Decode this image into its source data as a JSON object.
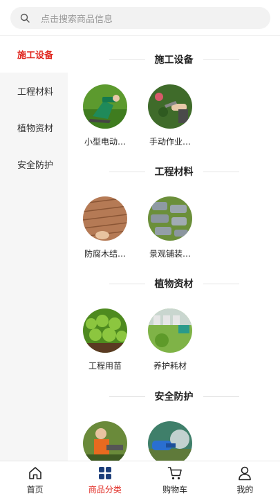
{
  "search": {
    "placeholder": "点击搜索商品信息"
  },
  "sidebar": {
    "items": [
      {
        "label": "施工设备",
        "active": true
      },
      {
        "label": "工程材料",
        "active": false
      },
      {
        "label": "植物资材",
        "active": false
      },
      {
        "label": "安全防护",
        "active": false
      }
    ]
  },
  "sections": [
    {
      "title": "施工设备",
      "products": [
        {
          "name": "小型电动…",
          "image": "hedge-trimmer-photo"
        },
        {
          "name": "手动作业…",
          "image": "pruning-shears-photo"
        }
      ]
    },
    {
      "title": "工程材料",
      "products": [
        {
          "name": "防腐木结…",
          "image": "wood-deck-photo"
        },
        {
          "name": "景观铺装…",
          "image": "stone-paving-photo"
        }
      ]
    },
    {
      "title": "植物资材",
      "products": [
        {
          "name": "工程用苗",
          "image": "seedlings-photo"
        },
        {
          "name": "养护耗材",
          "image": "irrigation-photo"
        }
      ]
    },
    {
      "title": "安全防护",
      "products": [
        {
          "name": "",
          "image": "worker-gear-photo"
        },
        {
          "name": "",
          "image": "sprayer-photo"
        }
      ]
    }
  ],
  "tabbar": {
    "items": [
      {
        "label": "首页",
        "icon": "home-icon",
        "active": false
      },
      {
        "label": "商品分类",
        "icon": "category-icon",
        "active": true
      },
      {
        "label": "购物车",
        "icon": "cart-icon",
        "active": false
      },
      {
        "label": "我的",
        "icon": "user-icon",
        "active": false
      }
    ]
  },
  "colors": {
    "accent": "#e0261e",
    "category_icon": "#1d3f7a",
    "sidebar_bg": "#f6f6f6"
  }
}
